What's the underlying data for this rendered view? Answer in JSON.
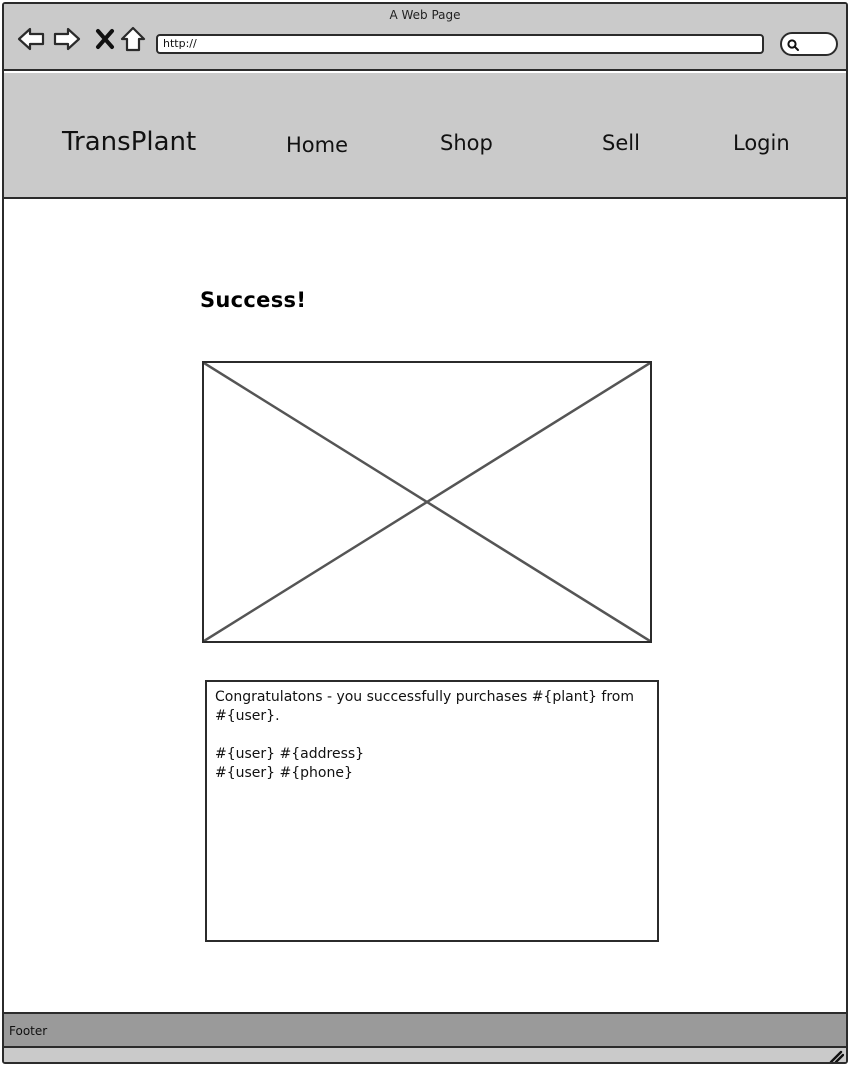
{
  "browser": {
    "title": "A Web Page",
    "url": "http://"
  },
  "header": {
    "brand": "TransPlant",
    "nav": [
      {
        "label": "Home"
      },
      {
        "label": "Shop"
      },
      {
        "label": "Sell"
      },
      {
        "label": "Login"
      }
    ]
  },
  "main": {
    "heading": "Success!",
    "message": {
      "line1": "Congratulatons - you successfully purchases #{plant} from #{user}.",
      "line2": "#{user} #{address}",
      "line3": "#{user} #{phone}"
    }
  },
  "footer": {
    "label": "Footer"
  },
  "icons": {
    "back": "arrow-left-icon",
    "forward": "arrow-right-icon",
    "stop": "close-icon",
    "home": "home-icon",
    "search": "search-icon",
    "image": "image-placeholder-icon",
    "resize": "resize-grip-icon"
  },
  "colors": {
    "chrome": "#cacaca",
    "footer": "#9a9a9a",
    "stroke": "#2b2b2b",
    "background": "#ffffff"
  }
}
